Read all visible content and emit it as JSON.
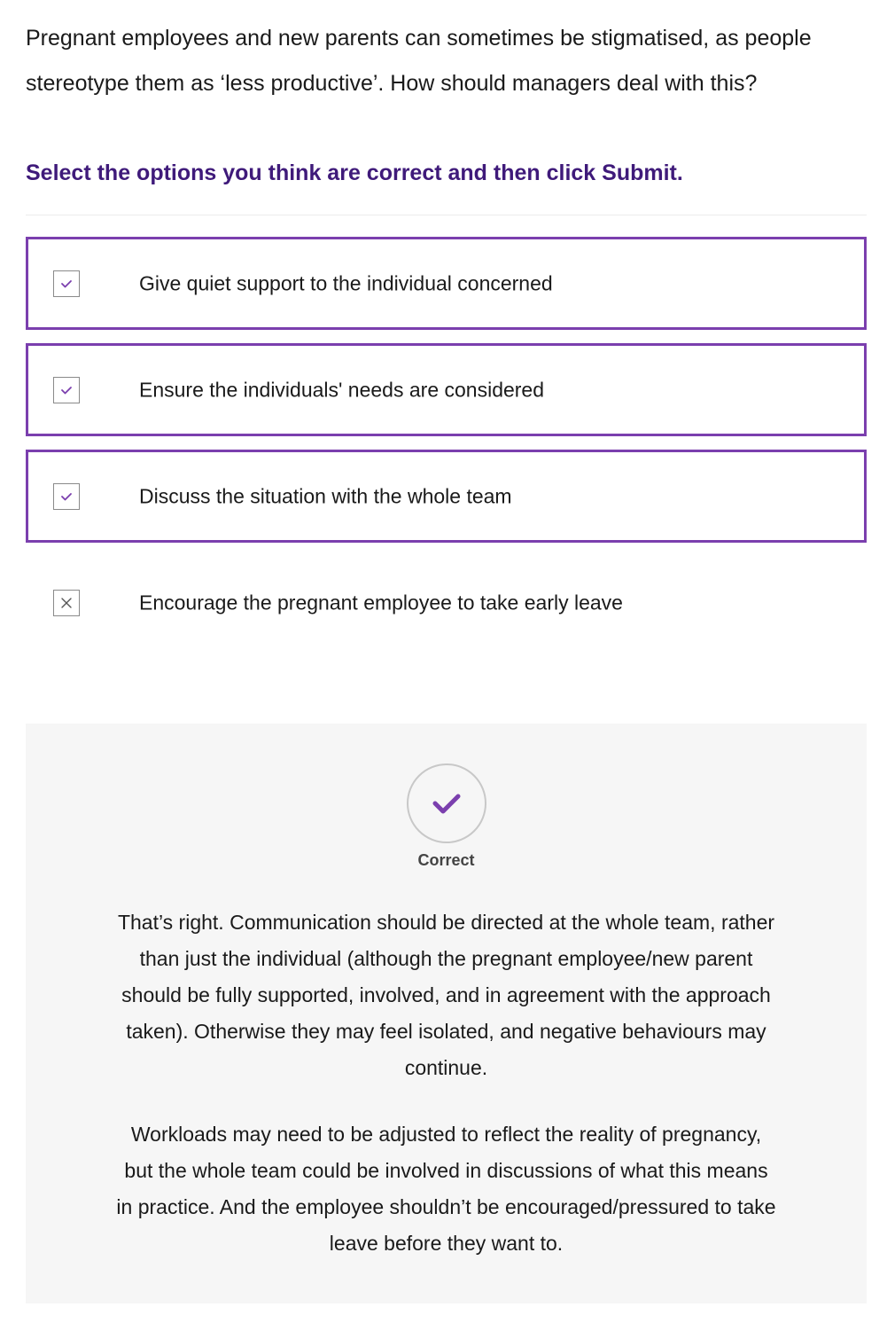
{
  "question": {
    "text": "Pregnant employees and new parents can sometimes be stigmatised, as people stereotype them as ‘less productive’. How should managers deal with this?"
  },
  "instruction": "Select the options you think are correct and then click Submit.",
  "options": [
    {
      "label": "Give quiet support to the individual concerned",
      "selected": true,
      "icon": "check-icon"
    },
    {
      "label": "Ensure the individuals' needs are considered",
      "selected": true,
      "icon": "check-icon"
    },
    {
      "label": "Discuss the situation with the whole team",
      "selected": true,
      "icon": "check-icon"
    },
    {
      "label": "Encourage the pregnant employee to take early leave",
      "selected": false,
      "icon": "cross-icon"
    }
  ],
  "feedback": {
    "icon": "check-icon",
    "status": "Correct",
    "paragraphs": [
      "That’s right.  Communication should be directed at the whole team, rather than just the individual (although the pregnant employee/new parent should be fully supported, involved, and in agreement with the approach taken). Otherwise they may feel isolated, and negative behaviours may continue.",
      "Workloads may need to be adjusted to reflect the reality of pregnancy, but the whole team could be involved in discussions of what this means in practice. And the employee shouldn’t be encouraged/pressured to take leave before they want to."
    ]
  },
  "colors": {
    "accent": "#7b3fae",
    "instruction": "#3f1a7a",
    "feedback_bg": "#f6f6f6"
  }
}
